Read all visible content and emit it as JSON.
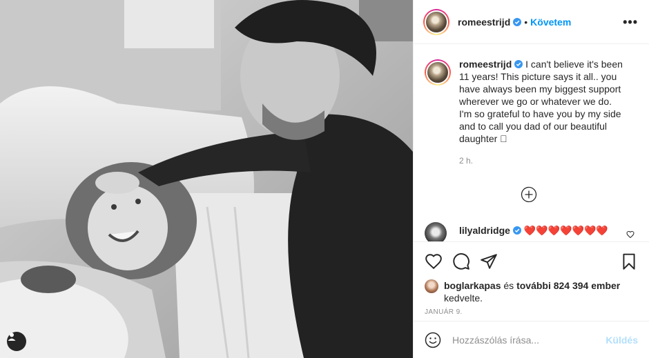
{
  "post": {
    "username": "romeestrijd",
    "follow_label": "Követem",
    "dot": "•",
    "more_label": "•••"
  },
  "caption": {
    "username": "romeestrijd",
    "text": "I can't believe it's been 11 years! This picture says it all.. you have always been my biggest support wherever we go or whatever we do. I'm so grateful to have you by my side and to call you dad of our beautiful daughter 🏼",
    "time": "2 h."
  },
  "comment": {
    "username": "lilyaldridge",
    "text": "❤️❤️❤️❤️❤️❤️❤️"
  },
  "likes": {
    "first_user": "boglarkapas",
    "middle": " és ",
    "others": "további 824 394 ember",
    "suffix": "kedvelte."
  },
  "date": "JANUÁR 9.",
  "composer": {
    "placeholder": "Hozzászólás írása...",
    "send_label": "Küldés"
  },
  "icons": {
    "like": "heart-icon",
    "comment": "comment-icon",
    "share": "paper-plane-icon",
    "save": "bookmark-icon",
    "emoji": "smiley-icon",
    "user_tag": "user-icon"
  }
}
